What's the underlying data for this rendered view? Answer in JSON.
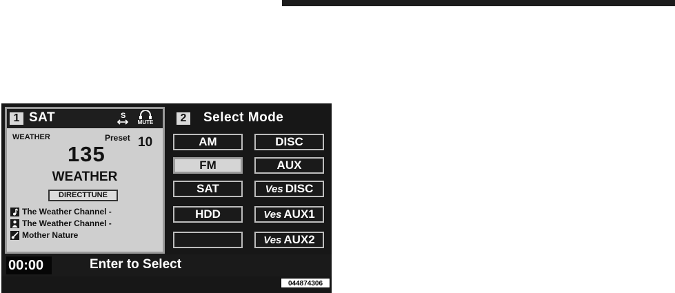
{
  "source_panel": {
    "number": "1",
    "title": "SAT",
    "mute_label": "MUTE",
    "category": "WEATHER",
    "preset_label": "Preset",
    "preset_number": "10",
    "channel_number": "135",
    "channel_name": "WEATHER",
    "direct_tune_label": "DIRECTTUNE",
    "info": [
      {
        "icon": "music-note-icon",
        "text": "The Weather Channel -"
      },
      {
        "icon": "artist-icon",
        "text": "The Weather Channel -"
      },
      {
        "icon": "guitar-icon",
        "text": "Mother Nature"
      }
    ]
  },
  "select_mode": {
    "number": "2",
    "title": "Select Mode",
    "buttons": [
      {
        "label": "AM",
        "selected": false
      },
      {
        "label": "DISC",
        "selected": false
      },
      {
        "label": "FM",
        "selected": true
      },
      {
        "label": "AUX",
        "selected": false
      },
      {
        "label": "SAT",
        "selected": false
      },
      {
        "prefix": "Ves",
        "label": "DISC",
        "selected": false
      },
      {
        "label": "HDD",
        "selected": false
      },
      {
        "prefix": "Ves",
        "label": "AUX1",
        "selected": false
      },
      {
        "label": "",
        "selected": false
      },
      {
        "prefix": "Ves",
        "label": "AUX2",
        "selected": false
      }
    ]
  },
  "status_bar": {
    "time": "00:00",
    "message": "Enter to Select"
  },
  "image_code": "044874306",
  "colors": {
    "screen_bg": "#171717",
    "panel_bg": "#cfcfcf",
    "selected_button_bg": "#d5d5d5"
  }
}
